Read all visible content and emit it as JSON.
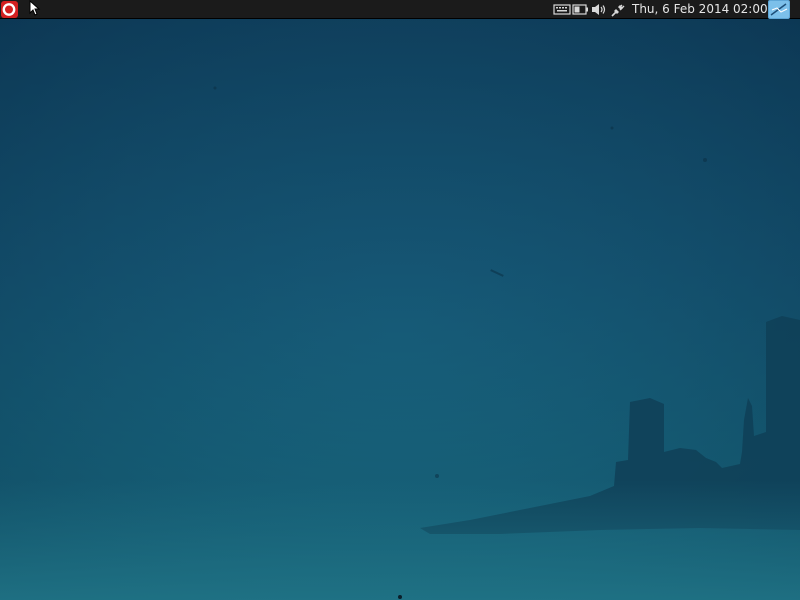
{
  "panel": {
    "menu_icon": "app-menu-icon",
    "tray": {
      "keyboard_icon": "keyboard-layout-icon",
      "battery_icon": "battery-icon",
      "volume_icon": "volume-icon",
      "network_icon": "network-disconnected-icon"
    },
    "clock": "Thu,  6 Feb 2014 02:00",
    "apps_icon": "workspace-switcher-icon"
  },
  "desktop": {
    "wallpaper": "blue-textured-factory-silhouette",
    "colors": {
      "panel_bg": "#1b1b1b",
      "wallpaper_top": "#0f3e5e",
      "wallpaper_bottom": "#1a6c80",
      "silhouette": "#0f3f57"
    }
  }
}
